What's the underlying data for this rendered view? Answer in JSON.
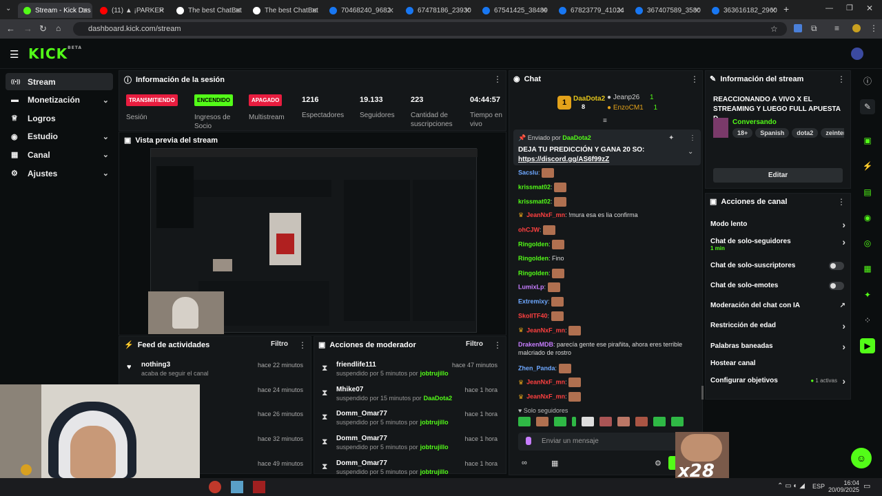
{
  "browser": {
    "tabs": [
      {
        "label": "Stream - Kick Das",
        "color": "#53fc18",
        "active": true
      },
      {
        "label": "(11) ▲ ¡PARKER",
        "color": "#ff0000"
      },
      {
        "label": "The best ChatBot",
        "color": "#ffffff"
      },
      {
        "label": "The best ChatBot",
        "color": "#ffffff"
      },
      {
        "label": "70468240_9682",
        "color": "#1877f2"
      },
      {
        "label": "67478186_23930",
        "color": "#1877f2"
      },
      {
        "label": "67541425_38489",
        "color": "#1877f2"
      },
      {
        "label": "67823779_41024",
        "color": "#1877f2"
      },
      {
        "label": "367407589_3580",
        "color": "#1877f2"
      },
      {
        "label": "363616182_2960",
        "color": "#1877f2"
      }
    ],
    "url": "dashboard.kick.com/stream"
  },
  "header": {
    "logo": "KICK",
    "logo_sup": "BETA"
  },
  "sidebar": {
    "items": [
      {
        "label": "Stream",
        "icon": "broadcast-icon",
        "expand": false
      },
      {
        "label": "Monetización",
        "icon": "money-icon",
        "expand": true
      },
      {
        "label": "Logros",
        "icon": "trophy-icon",
        "expand": false
      },
      {
        "label": "Estudio",
        "icon": "studio-icon",
        "expand": true
      },
      {
        "label": "Canal",
        "icon": "channel-icon",
        "expand": true
      },
      {
        "label": "Ajustes",
        "icon": "gear-icon",
        "expand": true
      }
    ]
  },
  "session": {
    "title": "Información de la sesión",
    "stats": [
      {
        "badge": "TRANSMITIENDO",
        "badge_color": "#e81d3f",
        "label": "Sesión"
      },
      {
        "badge": "ENCENDIDO",
        "badge_color": "#53fc18",
        "label": "Ingresos de Socio"
      },
      {
        "badge": "APAGADO",
        "badge_color": "#e81d3f",
        "label": "Multistream"
      },
      {
        "value": "1216",
        "label": "Espectadores"
      },
      {
        "value": "19.133",
        "label": "Seguidores"
      },
      {
        "value": "223",
        "label": "Cantidad de suscripciones"
      },
      {
        "value": "04:44:57",
        "label": "Tiempo en vivo"
      }
    ]
  },
  "preview": {
    "title": "Vista previa del stream"
  },
  "feed": {
    "title": "Feed de actividades",
    "filter": "Filtro",
    "rows": [
      {
        "name": "nothing3",
        "desc": "acaba de seguir el canal",
        "time": "hace 22 minutos"
      },
      {
        "name": "",
        "desc": "",
        "time": "hace 24 minutos"
      },
      {
        "name": "",
        "desc": "",
        "time": "hace 26 minutos"
      },
      {
        "name": "",
        "desc": "",
        "time": "hace 32 minutos"
      },
      {
        "name": "",
        "desc": "",
        "time": "hace 49 minutos"
      }
    ]
  },
  "modactions": {
    "title": "Acciones de moderador",
    "filter": "Filtro",
    "rows": [
      {
        "name": "friendlife111",
        "desc": "suspendido por 5 minutos por",
        "by": "jobtrujillo",
        "time": "hace 47 minutos"
      },
      {
        "name": "Mhike07",
        "desc": "suspendido por 15 minutos por",
        "by": "DaaDota2",
        "time": "hace 1 hora"
      },
      {
        "name": "Domm_Omar77",
        "desc": "suspendido por 5 minutos por",
        "by": "jobtrujillo",
        "time": "hace 1 hora"
      },
      {
        "name": "Domm_Omar77",
        "desc": "suspendido por 5 minutos por",
        "by": "jobtrujillo",
        "time": "hace 1 hora"
      },
      {
        "name": "Domm_Omar77",
        "desc": "suspendido por 5 minutos por",
        "by": "jobtrujillo",
        "time": "hace 1 hora"
      }
    ]
  },
  "chat": {
    "title": "Chat",
    "top": [
      {
        "rank": "1",
        "name": "DaaDota2",
        "count": "8"
      },
      {
        "rank": "",
        "name": "Jeanp26",
        "count": "1"
      },
      {
        "rank": "",
        "name": "EnzoCM1",
        "count": "1"
      }
    ],
    "pinned": {
      "sent_by": "Enviado por",
      "user": "DaaDota2",
      "text": "DEJA TU PREDICCIÓN Y GANA 20 SO:",
      "link": "https://discord.gg/AS6f99zZ"
    },
    "messages": [
      {
        "user": "Sacslu",
        "color": "#6ea8ff",
        "text": ""
      },
      {
        "user": "krissmat02",
        "color": "#53fc18",
        "text": ""
      },
      {
        "user": "krissmat02",
        "color": "#53fc18",
        "text": ""
      },
      {
        "user": "JeanNxF_mn",
        "color": "#ff4040",
        "text": "!mura esa es lia confirma"
      },
      {
        "user": "ohCJW",
        "color": "#ff4040",
        "text": ""
      },
      {
        "user": "Ringolden",
        "color": "#53fc18",
        "text": ""
      },
      {
        "user": "Ringolden",
        "color": "#53fc18",
        "text": "Fino"
      },
      {
        "user": "Ringolden",
        "color": "#53fc18",
        "text": ""
      },
      {
        "user": "LumixLp",
        "color": "#c77dff",
        "text": ""
      },
      {
        "user": "Extremixy",
        "color": "#6ea8ff",
        "text": ""
      },
      {
        "user": "SkollTF40",
        "color": "#ff4040",
        "text": ""
      },
      {
        "user": "JeanNxF_mn",
        "color": "#ff4040",
        "text": ""
      },
      {
        "user": "DrakenMDB",
        "color": "#c77dff",
        "text": "parecía gente ese pirañita, ahora eres terrible malcriado de rostro"
      },
      {
        "user": "Zhen_Panda",
        "color": "#6ea8ff",
        "text": ""
      },
      {
        "user": "JeanNxF_mn",
        "color": "#ff4040",
        "text": ""
      },
      {
        "user": "JeanNxF_mn",
        "color": "#ff4040",
        "text": ""
      }
    ],
    "followers_only": "Solo seguidores",
    "input_placeholder": "Enviar un mensaje",
    "overlay": "x28"
  },
  "streaminfo": {
    "title": "Información del stream",
    "stream_title": "REACCIONANDO A VIVO X EL STREAMING Y LUEGO FULL APUESTA D...",
    "category": "Conversando",
    "tags": [
      "18+",
      "Spanish",
      "dota2",
      "zeinternati"
    ],
    "edit": "Editar"
  },
  "channelactions": {
    "title": "Acciones de canal",
    "items": [
      {
        "label": "Modo lento",
        "type": "arrow"
      },
      {
        "label": "Chat de solo-seguidores",
        "sub": "1 min",
        "type": "arrow"
      },
      {
        "label": "Chat de solo-suscriptores",
        "type": "toggle"
      },
      {
        "label": "Chat de solo-emotes",
        "type": "toggle"
      },
      {
        "label": "Moderación del chat con IA",
        "type": "ext"
      },
      {
        "label": "Restricción de edad",
        "type": "arrow"
      },
      {
        "label": "Palabras baneadas",
        "type": "arrow"
      },
      {
        "label": "Hostear canal",
        "type": "none"
      },
      {
        "label": "Configurar objetivos",
        "extra": "1 activas",
        "type": "arrow"
      }
    ]
  },
  "taskbar": {
    "lang": "ESP",
    "time": "16:04",
    "date": "20/09/2025"
  },
  "colors": {
    "accent": "#53fc18",
    "live": "#e81d3f",
    "bg": "#0b0e0f",
    "panel": "#141719"
  }
}
